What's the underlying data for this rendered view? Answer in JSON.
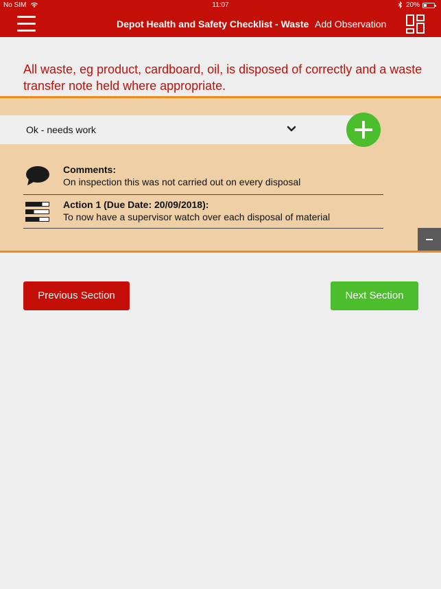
{
  "status_bar": {
    "carrier": "No SIM",
    "time": "11:07",
    "battery": "20%"
  },
  "nav": {
    "title": "Depot Health and Safety Checklist - Waste",
    "add_observation": "Add Observation"
  },
  "question": {
    "text": "All waste, eg product, cardboard, oil, is disposed of correctly and a waste transfer note held where appropriate."
  },
  "panel": {
    "selected_status": "Ok - needs work",
    "comments": {
      "label": "Comments:",
      "text": "On inspection this was not carried out on every disposal"
    },
    "action": {
      "label": "Action 1 (Due Date: 20/09/2018):",
      "text": "To now have a supervisor watch over each disposal of material"
    }
  },
  "buttons": {
    "previous": "Previous Section",
    "next": "Next Section"
  },
  "colors": {
    "brand_red": "#c40f08",
    "accent_green": "#4cbd2c",
    "panel_bg": "#eecfa6",
    "panel_border": "#ef8a1f"
  }
}
